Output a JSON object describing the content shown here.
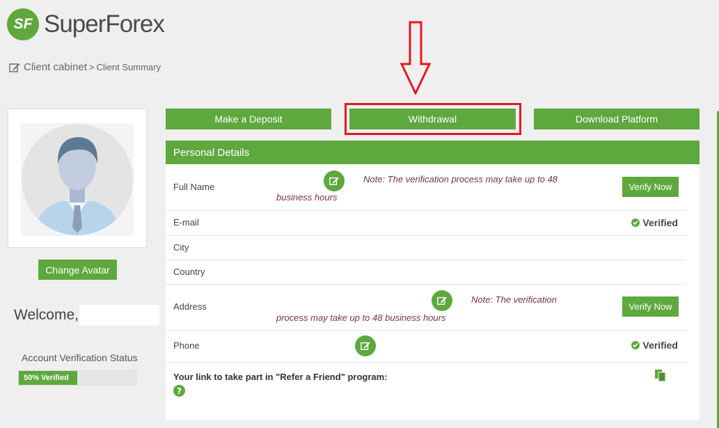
{
  "header": {
    "logo_mark": "SF",
    "logo_text": "SuperForex"
  },
  "breadcrumb": {
    "root": "Client cabinet",
    "separator": ">",
    "current": "Client Summary"
  },
  "actions": {
    "deposit_label": "Make a Deposit",
    "withdrawal_label": "Withdrawal",
    "download_label": "Download Platform"
  },
  "sidebar": {
    "change_avatar_label": "Change Avatar",
    "welcome_text": "Welcome,",
    "verification_status_label": "Account Verification Status",
    "verification_progress_text": "50% Verified",
    "verification_progress_value": 0.5
  },
  "personal_details": {
    "title": "Personal Details",
    "rows": [
      {
        "label": "Full Name",
        "note_line1": "Note: The verification process may take up to 48",
        "note_line2": "business hours",
        "button": "Verify Now"
      },
      {
        "label": "E-mail",
        "status": "Verified"
      },
      {
        "label": "City"
      },
      {
        "label": "Country"
      },
      {
        "label": "Address",
        "note_line1": "Note: The verification",
        "note_line2": "process may take up to 48 business hours",
        "button": "Verify Now"
      },
      {
        "label": "Phone",
        "status": "Verified"
      }
    ],
    "refer_text": "Your link to take part in \"Refer a Friend\" program:",
    "help_glyph": "?"
  },
  "colors": {
    "brand_green": "#5ea83e",
    "annotation_red": "#e3191f",
    "note_text": "#7a3050"
  }
}
